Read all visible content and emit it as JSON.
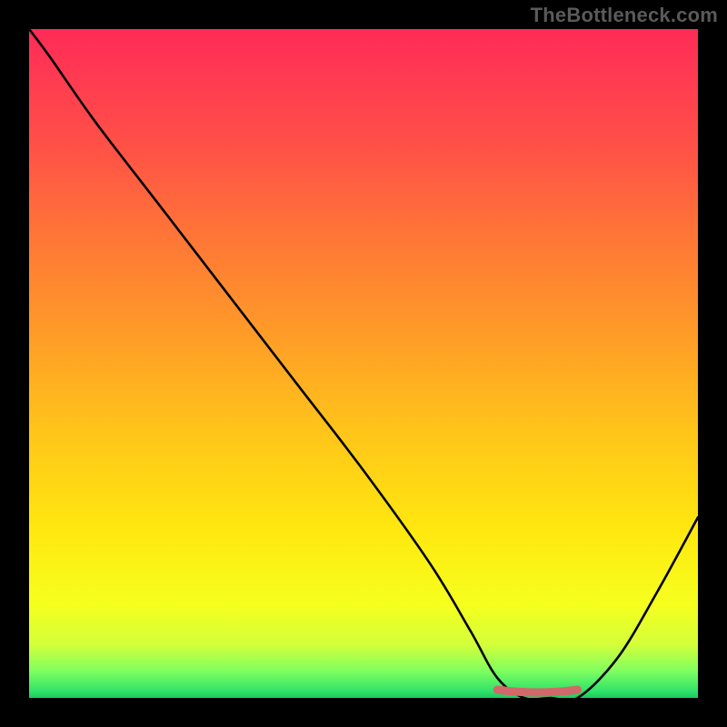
{
  "watermark": "TheBottleneck.com",
  "chart_data": {
    "type": "line",
    "title": "",
    "xlabel": "",
    "ylabel": "",
    "xlim": [
      0,
      100
    ],
    "ylim": [
      0,
      100
    ],
    "x": [
      0,
      3,
      10,
      20,
      30,
      40,
      50,
      60,
      66,
      70,
      74,
      78,
      82,
      88,
      94,
      100
    ],
    "values": [
      100,
      96,
      86,
      73,
      60,
      47,
      34,
      20,
      10,
      3,
      0,
      0,
      0,
      6,
      16,
      27
    ],
    "flat_region": {
      "approx_x_start": 70,
      "approx_x_end": 82,
      "value": 0
    },
    "colors": {
      "curve": "#000000",
      "flat_marker": "#d1686a",
      "gradient_top": "#ff2b55",
      "gradient_bottom": "#18c95e"
    }
  }
}
